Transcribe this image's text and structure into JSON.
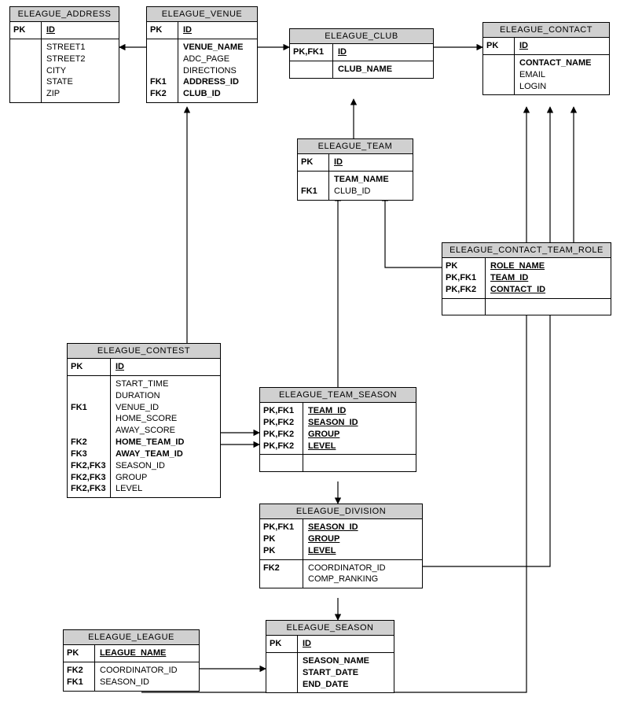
{
  "entities": {
    "address": {
      "title": "ELEAGUE_ADDRESS",
      "pk": "PK",
      "pk_attr": "ID",
      "attrs": [
        "STREET1",
        "STREET2",
        "CITY",
        "STATE",
        "ZIP"
      ]
    },
    "venue": {
      "title": "ELEAGUE_VENUE",
      "pk": "PK",
      "pk_attr": "ID",
      "keys": [
        "",
        "",
        "",
        "FK1",
        "FK2"
      ],
      "attrs": [
        "VENUE_NAME",
        "ADC_PAGE",
        "DIRECTIONS",
        "ADDRESS_ID",
        "CLUB_ID"
      ],
      "attr_styles": [
        "b",
        "",
        "",
        "b",
        "b"
      ]
    },
    "club": {
      "title": "ELEAGUE_CLUB",
      "pk": "PK,FK1",
      "pk_attr": "ID",
      "attrs": [
        "CLUB_NAME"
      ],
      "attr_styles": [
        "b"
      ]
    },
    "contact": {
      "title": "ELEAGUE_CONTACT",
      "pk": "PK",
      "pk_attr": "ID",
      "attrs": [
        "CONTACT_NAME",
        "EMAIL",
        "LOGIN"
      ],
      "attr_styles": [
        "b",
        "",
        ""
      ]
    },
    "team": {
      "title": "ELEAGUE_TEAM",
      "pk": "PK",
      "pk_attr": "ID",
      "keys": [
        "",
        "FK1"
      ],
      "attrs": [
        "TEAM_NAME",
        "CLUB_ID"
      ],
      "attr_styles": [
        "b",
        ""
      ]
    },
    "contact_team_role": {
      "title": "ELEAGUE_CONTACT_TEAM_ROLE",
      "pk_keys": [
        "PK",
        "PK,FK1",
        "PK,FK2"
      ],
      "pk_attrs": [
        "ROLE_NAME",
        "TEAM_ID",
        "CONTACT_ID"
      ]
    },
    "contest": {
      "title": "ELEAGUE_CONTEST",
      "pk": "PK",
      "pk_attr": "ID",
      "keys": [
        "",
        "",
        "FK1",
        "",
        "",
        "FK2",
        "FK3",
        "FK2,FK3",
        "FK2,FK3",
        "FK2,FK3"
      ],
      "attrs": [
        "START_TIME",
        "DURATION",
        "VENUE_ID",
        "HOME_SCORE",
        "AWAY_SCORE",
        "HOME_TEAM_ID",
        "AWAY_TEAM_ID",
        "SEASON_ID",
        "GROUP",
        "LEVEL"
      ],
      "attr_styles": [
        "",
        "",
        "",
        "",
        "",
        "b",
        "b",
        "",
        "",
        ""
      ]
    },
    "team_season": {
      "title": "ELEAGUE_TEAM_SEASON",
      "pk_keys": [
        "PK,FK1",
        "PK,FK2",
        "PK,FK2",
        "PK,FK2"
      ],
      "pk_attrs": [
        "TEAM_ID",
        "SEASON_ID",
        "GROUP",
        "LEVEL"
      ]
    },
    "division": {
      "title": "ELEAGUE_DIVISION",
      "pk_keys": [
        "PK,FK1",
        "PK",
        "PK"
      ],
      "pk_attrs": [
        "SEASON_ID",
        "GROUP",
        "LEVEL"
      ],
      "keys": [
        "FK2",
        ""
      ],
      "attrs": [
        "COORDINATOR_ID",
        "COMP_RANKING"
      ]
    },
    "season": {
      "title": "ELEAGUE_SEASON",
      "pk": "PK",
      "pk_attr": "ID",
      "attrs": [
        "SEASON_NAME",
        "START_DATE",
        "END_DATE"
      ],
      "attr_styles": [
        "b",
        "b",
        "b"
      ]
    },
    "league": {
      "title": "ELEAGUE_LEAGUE",
      "pk": "PK",
      "pk_attr": "LEAGUE_NAME",
      "keys": [
        "FK2",
        "FK1"
      ],
      "attrs": [
        "COORDINATOR_ID",
        "SEASON_ID"
      ]
    }
  }
}
